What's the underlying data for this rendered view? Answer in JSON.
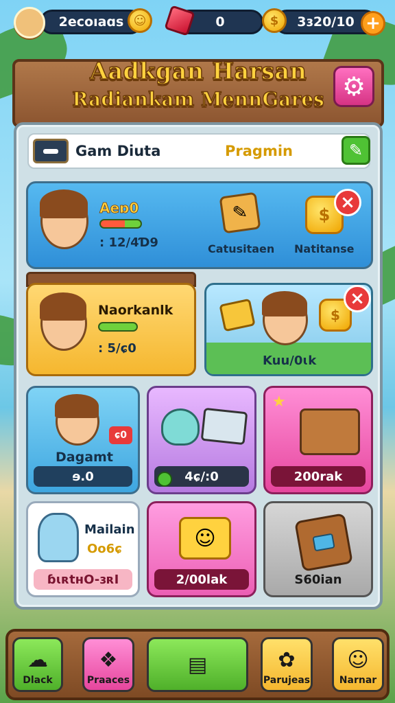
{
  "topbar": {
    "currency1": "2ecoıaɑs",
    "gems": "0",
    "currency2": "3ɜ20/10",
    "icons": [
      "avatar",
      "coin-icon",
      "gem-icon",
      "coin-icon",
      "plus-icon"
    ]
  },
  "header": {
    "title_line1": "Aadkgan Harsan",
    "title_line2": "Radiankam MennGares"
  },
  "panel": {
    "row_left": "Gam Diuta",
    "row_right": "Pragmin",
    "card1": {
      "name": "Aeɒ0",
      "stat": ": 12/4Ɗ9",
      "item1": "Catusitaen",
      "item2": "Natitanse"
    },
    "card2": {
      "name": "Naorkanlk",
      "stat": ": 5/ɕ0"
    },
    "card3": {
      "name": "Kuu/0ɩk"
    },
    "tile1": {
      "name": "Dagamt",
      "badge": "ɕ0",
      "footer": "ɘ.0"
    },
    "tile2": {
      "footer": "4ɕ/:0"
    },
    "tile3": {
      "footer": "200rak"
    },
    "tile4": {
      "name": "Mailain",
      "sub": "Oo6ɕ",
      "footer": "ɓɩʀtʜO-ɜʀI"
    },
    "tile5": {
      "footer": "2/00lak"
    },
    "tile6": {
      "footer": "S60ian"
    }
  },
  "nav": [
    {
      "label": "Dlack",
      "color": "#6fd13c"
    },
    {
      "label": "Praaces",
      "color": "#ff6ec7"
    },
    {
      "label": "",
      "color": "#6fd13c"
    },
    {
      "label": "Parujeas",
      "color": "#ffc93c"
    },
    {
      "label": "Narnar",
      "color": "#ffc93c"
    }
  ]
}
